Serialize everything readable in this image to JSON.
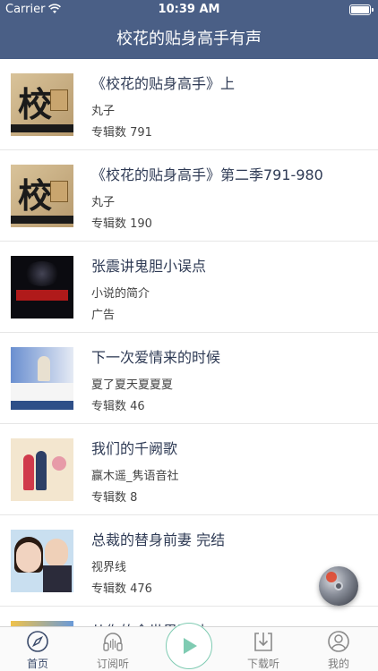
{
  "status": {
    "carrier": "Carrier",
    "time": "10:39 AM"
  },
  "nav": {
    "title": "校花的贴身高手有声"
  },
  "items": [
    {
      "title": "《校花的贴身高手》上",
      "author": "丸子",
      "meta": "专辑数 791",
      "cover": "book-cover-xiaohua"
    },
    {
      "title": "《校花的贴身高手》第二季791-980",
      "author": "丸子",
      "meta": "专辑数 190",
      "cover": "book-cover-xiaohua"
    },
    {
      "title": "张震讲鬼胆小误点",
      "author": "小说的简介",
      "meta": "广告",
      "cover": "ghost-story-cover"
    },
    {
      "title": "下一次爱情来的时候",
      "author": "夏了夏天夏夏夏",
      "meta": "专辑数 46",
      "cover": "romance-cover"
    },
    {
      "title": "我们的千阙歌",
      "author": "赢木遥_隽语音社",
      "meta": "专辑数 8",
      "cover": "couple-cover"
    },
    {
      "title": "总裁的替身前妻 完结",
      "author": "视界线",
      "meta": "专辑数 476",
      "cover": "ceo-couple-cover"
    },
    {
      "title": "从你的全世界路过",
      "author": "",
      "meta": "",
      "cover": "partial-cover"
    }
  ],
  "tabs": [
    {
      "label": "首页",
      "icon": "compass-icon",
      "active": true
    },
    {
      "label": "订阅听",
      "icon": "headphones-icon",
      "active": false
    },
    {
      "label": "",
      "icon": "play-icon",
      "active": false
    },
    {
      "label": "下载听",
      "icon": "download-icon",
      "active": false
    },
    {
      "label": "我的",
      "icon": "user-icon",
      "active": false
    }
  ],
  "colors": {
    "navbar": "#4a5f86",
    "accent": "#7fcbb2"
  }
}
